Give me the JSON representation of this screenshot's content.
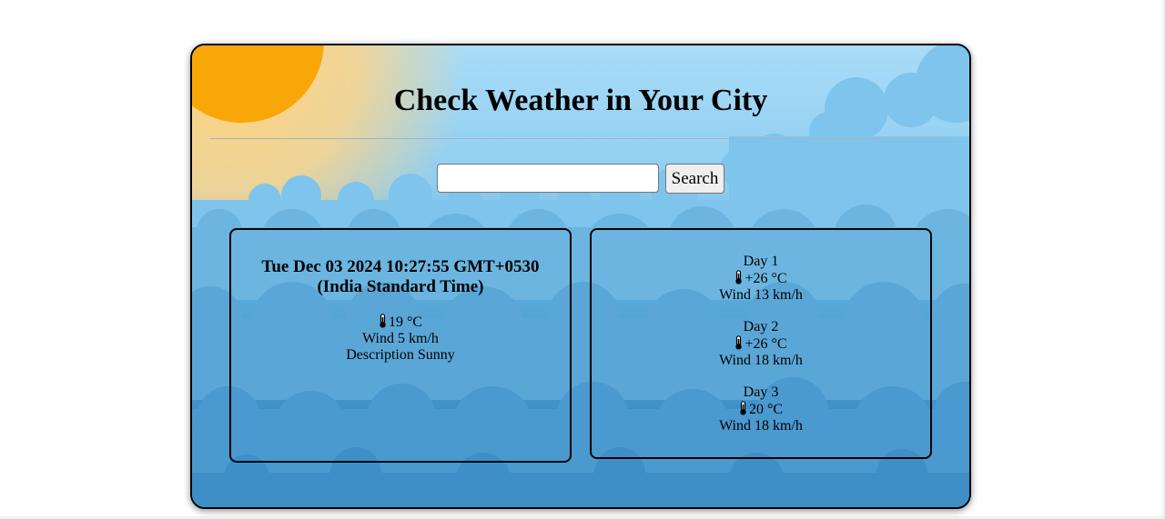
{
  "header": {
    "title": "Check Weather in Your City"
  },
  "search": {
    "placeholder": "",
    "value": "",
    "button_label": "Search"
  },
  "current": {
    "date_line1": "Tue Dec 03 2024 10:27:55 GMT+0530",
    "date_line2": "(India Standard Time)",
    "temperature": "19 °C",
    "wind": "Wind 5 km/h",
    "description": "Description Sunny"
  },
  "forecast": {
    "days": [
      {
        "label": "Day 1",
        "temperature": "+26 °C",
        "wind": "Wind 13 km/h"
      },
      {
        "label": "Day 2",
        "temperature": "+26 °C",
        "wind": "Wind 18 km/h"
      },
      {
        "label": "Day 3",
        "temperature": "20 °C",
        "wind": "Wind 18 km/h"
      }
    ]
  },
  "icons": {
    "temperature": "thermometer-icon",
    "background_sun": "sun-illustration",
    "background_clouds": "clouds-illustration"
  },
  "colors": {
    "sky_top": "#a8dcf7",
    "sky_bottom": "#3684be",
    "sun": "#f9a608"
  }
}
